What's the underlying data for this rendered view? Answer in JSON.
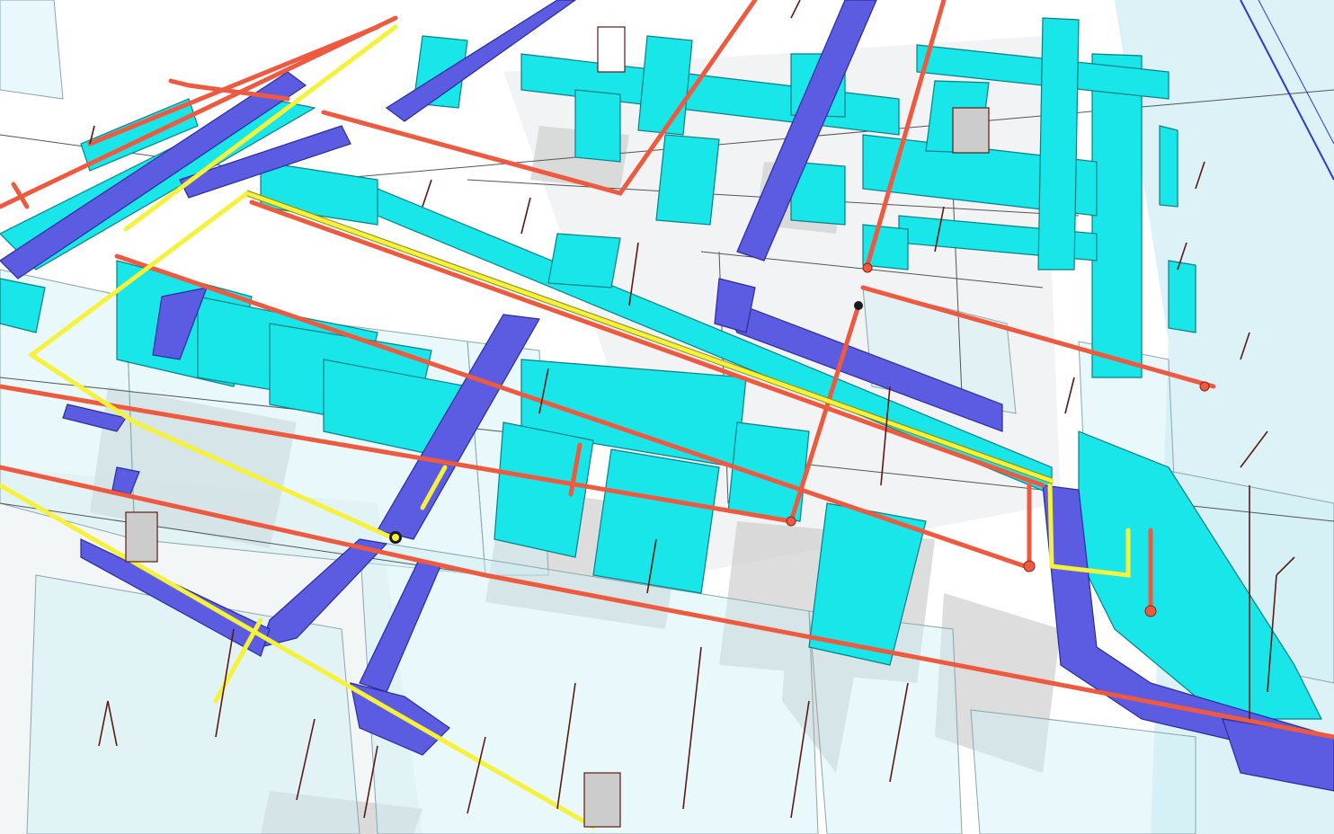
{
  "colors": {
    "background": "#ffffff",
    "floor_shadow": "#cfcfcf",
    "wall_glass": "#cfeff5",
    "wall_edge": "#8aa6ad",
    "supply_duct": "#19e6e9",
    "supply_duct_edge": "#0a7f86",
    "return_duct": "#5b5ce2",
    "return_duct_edge": "#2b2c9a",
    "hot_pipe": "#ee5a3f",
    "hot_pipe_edge": "#8a2314",
    "yellow_pipe": "#f6f13a",
    "yellow_pipe_edge": "#8c8a10",
    "hanger": "#5a1a10",
    "grid_line": "#444444"
  },
  "scene": {
    "systems": [
      "supply-air-duct",
      "return-air-duct",
      "heating-water-pipe",
      "condensate-pipe",
      "duct-hangers"
    ]
  }
}
